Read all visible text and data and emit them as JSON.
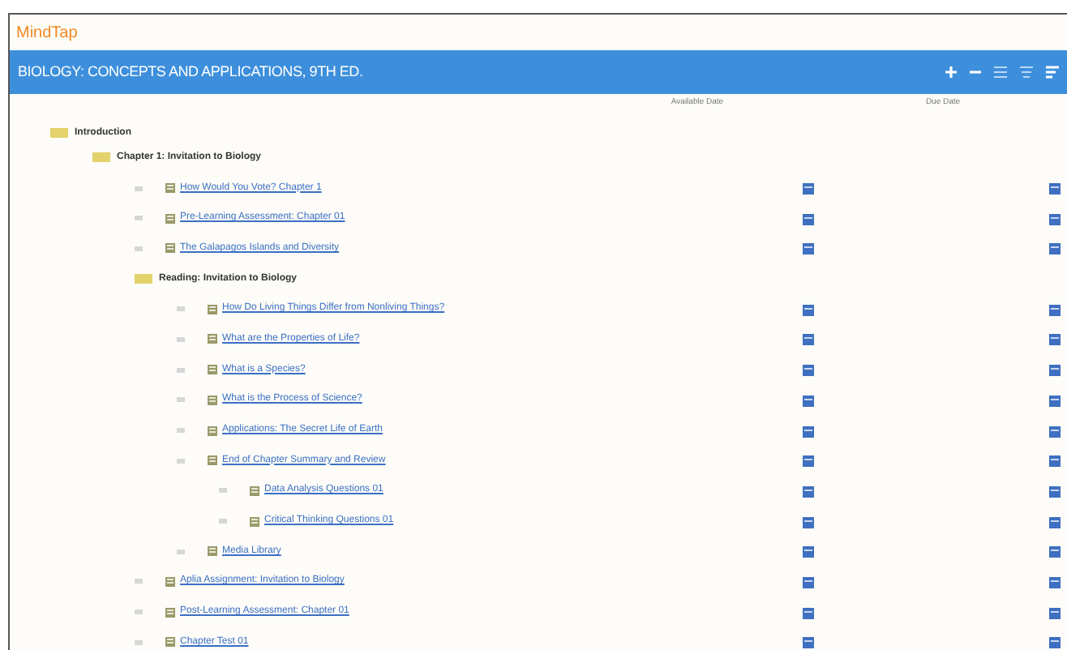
{
  "app": {
    "logo": "MindTap"
  },
  "header": {
    "title": "BIOLOGY: CONCEPTS AND APPLICATIONS, 9TH ED."
  },
  "columns": [
    "Available Date",
    "Due Date"
  ],
  "tree": [
    {
      "kind": "folder",
      "label": "Introduction",
      "children": [
        {
          "kind": "folder",
          "label": "Chapter 1: Invitation to Biology",
          "children": [
            {
              "kind": "activity",
              "label": "How Would You Vote? Chapter 1"
            },
            {
              "kind": "activity",
              "label": "Pre-Learning Assessment: Chapter 01"
            },
            {
              "kind": "activity",
              "label": "The Galapagos Islands and Diversity"
            },
            {
              "kind": "folder",
              "label": "Reading: Invitation to Biology",
              "children": [
                {
                  "kind": "activity",
                  "label": "How Do Living Things Differ from Nonliving Things?"
                },
                {
                  "kind": "activity",
                  "label": "What are the Properties of Life?"
                },
                {
                  "kind": "activity",
                  "label": "What is a Species?"
                },
                {
                  "kind": "activity",
                  "label": "What is the Process of Science?"
                },
                {
                  "kind": "activity",
                  "label": "Applications: The Secret Life of Earth"
                },
                {
                  "kind": "activity",
                  "label": "End of Chapter Summary and Review",
                  "children": [
                    {
                      "kind": "activity",
                      "label": "Data Analysis Questions 01"
                    },
                    {
                      "kind": "activity",
                      "label": "Critical Thinking Questions 01"
                    }
                  ]
                },
                {
                  "kind": "activity",
                  "label": "Media Library"
                }
              ]
            },
            {
              "kind": "activity",
              "label": "Aplia Assignment: Invitation to Biology"
            },
            {
              "kind": "activity",
              "label": "Post-Learning Assessment: Chapter 01"
            },
            {
              "kind": "activity",
              "label": "Chapter Test 01"
            }
          ]
        }
      ]
    }
  ]
}
